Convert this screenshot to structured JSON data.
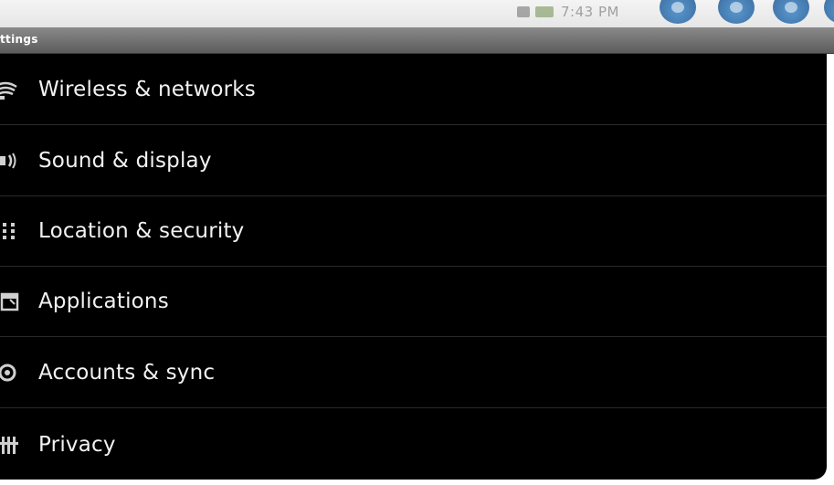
{
  "status_bar": {
    "time": "7:43 PM",
    "icons": [
      "notification-icon",
      "battery-icon"
    ],
    "buttons": [
      "home-button",
      "back-button",
      "refresh-button",
      "menu-button"
    ]
  },
  "title_bar": {
    "title": "ttings"
  },
  "settings": {
    "items": [
      {
        "label": "Wireless & networks",
        "icon": "wifi-icon"
      },
      {
        "label": "Sound & display",
        "icon": "sound-icon"
      },
      {
        "label": "Location & security",
        "icon": "location-grid-icon"
      },
      {
        "label": "Applications",
        "icon": "applications-icon"
      },
      {
        "label": "Accounts & sync",
        "icon": "sync-icon"
      },
      {
        "label": "Privacy",
        "icon": "privacy-icon"
      }
    ]
  },
  "colors": {
    "list_background": "#000000",
    "title_bar": "#6e6e6e",
    "status_bar": "#eeeeee",
    "accent_blue": "#2a6aa8",
    "text": "#f2f2f2"
  }
}
